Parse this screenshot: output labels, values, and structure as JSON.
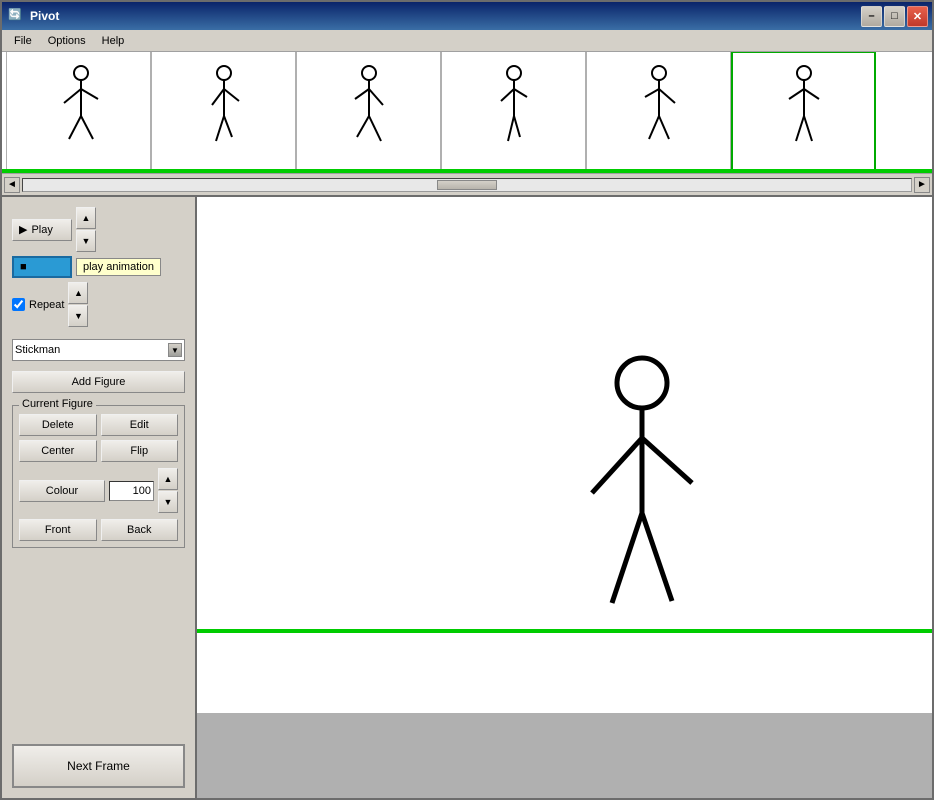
{
  "app": {
    "title": "Pivot",
    "icon": "🔄"
  },
  "titlebar": {
    "minimize": "–",
    "maximize": "□",
    "close": "✕"
  },
  "menu": {
    "items": [
      "File",
      "Options",
      "Help"
    ]
  },
  "timeline": {
    "frames": [
      {
        "id": 1,
        "active": false
      },
      {
        "id": 2,
        "active": false
      },
      {
        "id": 3,
        "active": false
      },
      {
        "id": 4,
        "active": false
      },
      {
        "id": 5,
        "active": false
      },
      {
        "id": 6,
        "active": true
      }
    ]
  },
  "controls": {
    "play_label": "Play",
    "stop_label": "play animation",
    "repeat_label": "Repeat",
    "spin_up": "▲",
    "spin_down": "▼"
  },
  "figure_selector": {
    "current": "Stickman",
    "options": [
      "Stickman"
    ],
    "add_label": "Add Figure"
  },
  "current_figure": {
    "group_label": "Current Figure",
    "delete_label": "Delete",
    "edit_label": "Edit",
    "center_label": "Center",
    "flip_label": "Flip",
    "colour_label": "Colour",
    "colour_value": "100",
    "front_label": "Front",
    "back_label": "Back"
  },
  "next_frame": {
    "label": "Next Frame"
  },
  "canvas": {
    "bg": "white"
  }
}
